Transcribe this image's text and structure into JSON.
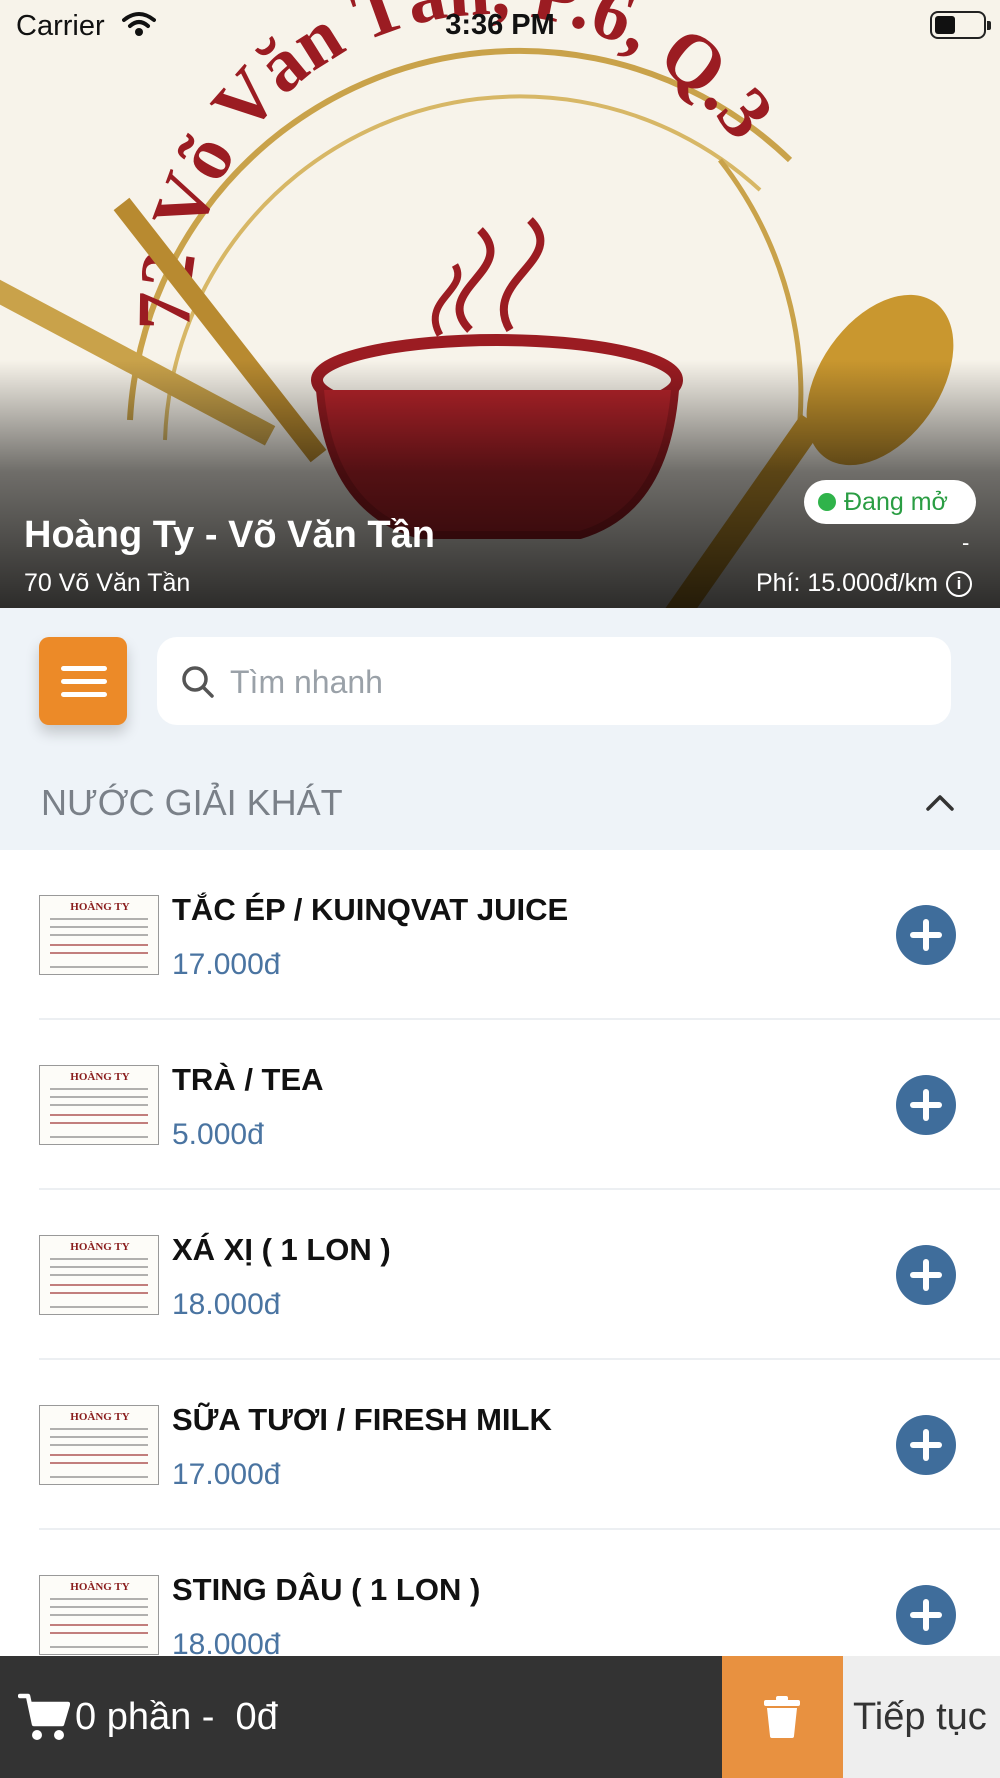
{
  "status_bar": {
    "carrier": "Carrier",
    "time": "3:36 PM"
  },
  "hero": {
    "logo_text": "72 Võ Văn Tần, P.6, Q.3",
    "store_name": "Hoàng Ty - Võ Văn Tần",
    "address": "70 Võ Văn Tần",
    "open_status": "Đang mở",
    "distance": "-",
    "fee": "Phí: 15.000đ/km"
  },
  "search": {
    "placeholder": "Tìm nhanh"
  },
  "category": {
    "title": "NƯỚC GIẢI KHÁT"
  },
  "items": [
    {
      "name": "TẮC ÉP / KUINQVAT JUICE",
      "price": "17.000đ",
      "thumb_text": "HOÀNG TY"
    },
    {
      "name": "TRÀ / TEA",
      "price": "5.000đ",
      "thumb_text": "HOÀNG TY"
    },
    {
      "name": "XÁ XỊ ( 1 LON )",
      "price": "18.000đ",
      "thumb_text": "HOÀNG TY"
    },
    {
      "name": "SỮA TƯƠI / FIRESH MILK",
      "price": "17.000đ",
      "thumb_text": "HOÀNG TY"
    },
    {
      "name": "STING DÂU ( 1 LON )",
      "price": "18.000đ",
      "thumb_text": "HOÀNG TY"
    }
  ],
  "cart": {
    "summary": "0 phần -  0đ",
    "continue_label": "Tiếp tục"
  },
  "colors": {
    "accent_orange": "#ec8a28",
    "price_blue": "#4a74a1",
    "add_button": "#3f6d9b",
    "open_green": "#2fb34a",
    "bottom_bar": "#333333"
  },
  "icons": [
    "wifi-icon",
    "battery-icon",
    "menu-icon",
    "search-icon",
    "chevron-up-icon",
    "add-icon",
    "cart-icon",
    "trash-icon",
    "info-icon",
    "status-dot-icon"
  ]
}
